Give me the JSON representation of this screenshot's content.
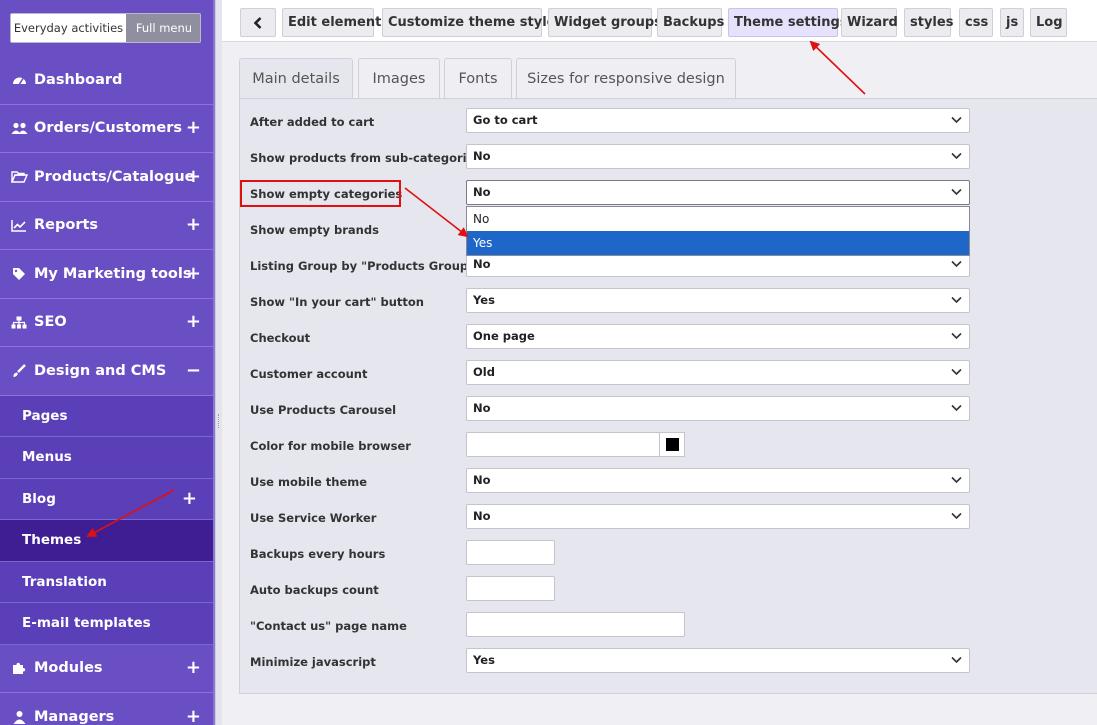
{
  "sidebar": {
    "mode_toggle": {
      "everyday": "Everyday activities",
      "full": "Full menu"
    },
    "items": [
      {
        "label": "Dashboard",
        "icon": "dashboard-icon",
        "expand": ""
      },
      {
        "label": "Orders/Customers",
        "icon": "users-icon",
        "expand": "+"
      },
      {
        "label": "Products/Catalogue",
        "icon": "folder-open-icon",
        "expand": "+"
      },
      {
        "label": "Reports",
        "icon": "chart-line-icon",
        "expand": "+"
      },
      {
        "label": "My Marketing tools",
        "icon": "tag-icon",
        "expand": "+"
      },
      {
        "label": "SEO",
        "icon": "sitemap-icon",
        "expand": "+"
      },
      {
        "label": "Design and CMS",
        "icon": "brush-icon",
        "expand": "−"
      }
    ],
    "sub_items": [
      {
        "label": "Pages",
        "expand": ""
      },
      {
        "label": "Menus",
        "expand": ""
      },
      {
        "label": "Blog",
        "expand": "+"
      },
      {
        "label": "Themes",
        "expand": ""
      },
      {
        "label": "Translation",
        "expand": ""
      },
      {
        "label": "E-mail templates",
        "expand": ""
      }
    ],
    "bottom_items": [
      {
        "label": "Modules",
        "icon": "puzzle-icon",
        "expand": "+"
      },
      {
        "label": "Managers",
        "icon": "user-icon",
        "expand": "+"
      }
    ]
  },
  "toolbar": {
    "back_icon": "chevron-left-icon",
    "buttons": [
      "Edit elements",
      "Customize theme styles",
      "Widget groups",
      "Backups",
      "Theme settings",
      "Wizard",
      "styles",
      "css",
      "js",
      "Log"
    ],
    "active": "Theme settings"
  },
  "tabs": [
    "Main details",
    "Images",
    "Fonts",
    "Sizes for responsive design"
  ],
  "active_tab": "Main details",
  "settings": {
    "after_added_to_cart": {
      "label": "After added to cart",
      "value": "Go to cart"
    },
    "show_products_from_sub_categories": {
      "label": "Show products from sub-categories",
      "value": "No"
    },
    "show_empty_categories": {
      "label": "Show empty categories",
      "value": "No"
    },
    "show_empty_brands": {
      "label": "Show empty brands",
      "value": ""
    },
    "listing_group_by_products_groups": {
      "label": "Listing Group by \"Products Groups\"",
      "value": "No"
    },
    "show_in_your_cart_button": {
      "label": "Show \"In your cart\" button",
      "value": "Yes"
    },
    "checkout": {
      "label": "Checkout",
      "value": "One page"
    },
    "customer_account": {
      "label": "Customer account",
      "value": "Old"
    },
    "use_products_carousel": {
      "label": "Use Products Carousel",
      "value": "No"
    },
    "color_for_mobile_browser": {
      "label": "Color for mobile browser",
      "value": ""
    },
    "use_mobile_theme": {
      "label": "Use mobile theme",
      "value": "No"
    },
    "use_service_worker": {
      "label": "Use Service Worker",
      "value": "No"
    },
    "backups_every_hours": {
      "label": "Backups every hours",
      "value": ""
    },
    "auto_backups_count": {
      "label": "Auto backups count",
      "value": ""
    },
    "contact_us_page_name": {
      "label": "\"Contact us\" page name",
      "value": ""
    },
    "minimize_javascript": {
      "label": "Minimize javascript",
      "value": "Yes"
    }
  },
  "dropdown_open": {
    "field": "show_empty_categories",
    "options": [
      "No",
      "Yes"
    ],
    "highlighted": "Yes"
  },
  "colors": {
    "sidebar_bg": "#6a4fc4",
    "submenu_bg": "#5a3fb8",
    "active_submenu_bg": "#3f1e94",
    "annotation_red": "#e01010",
    "dropdown_highlight": "#1f66c9",
    "mobile_browser_color_swatch": "#000000"
  }
}
